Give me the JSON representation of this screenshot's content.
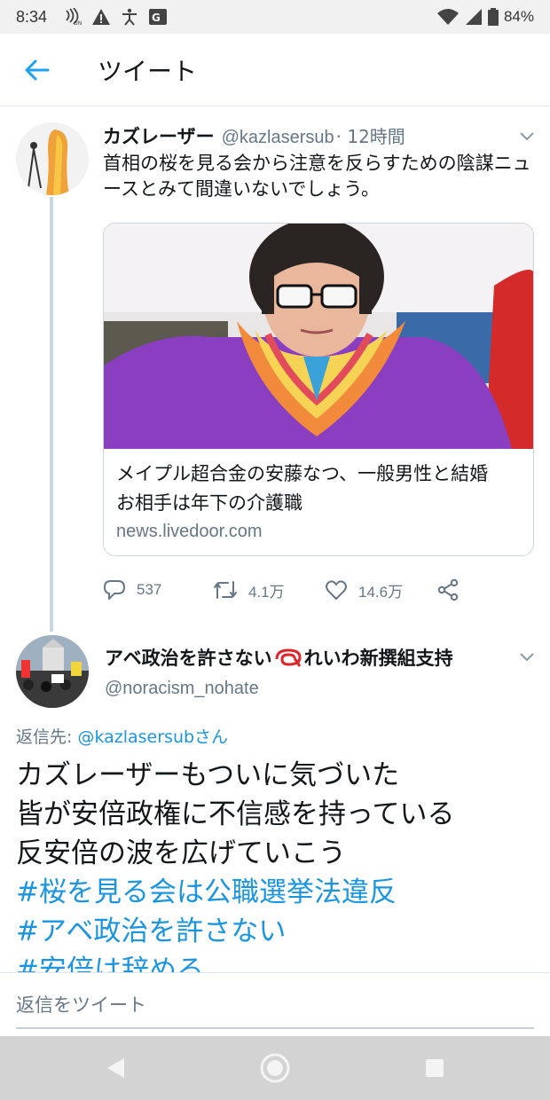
{
  "status_bar": {
    "time": "8:34",
    "battery": "84%",
    "icons": [
      "nfc-icon",
      "warning-icon",
      "accessibility-icon",
      "translate-icon",
      "wifi-icon",
      "signal-icon",
      "battery-icon"
    ]
  },
  "header": {
    "title": "ツイート",
    "back_icon": "arrow-left-icon"
  },
  "tweet": {
    "author_name": "カズレーザー",
    "author_handle": "@kazlasersub",
    "time": "· 12時間",
    "text": "首相の桜を見る会から注意を反らすための陰謀ニュースとみて間違いないでしょう。",
    "card": {
      "title": "メイプル超合金の安藤なつ、一般男性と結婚　お相手は年下の介護職",
      "domain": "news.livedoor.com"
    },
    "actions": {
      "replies": "537",
      "retweets": "4.1万",
      "likes": "14.6万"
    }
  },
  "reply": {
    "author_name_pre": "アベ政治を許さない",
    "author_name_post": "れいわ新撰組支持",
    "author_handle": "@noracism_nohate",
    "replying_label": "返信先: ",
    "replying_to": "@kazlasersubさん",
    "lines": [
      "カズレーザーもついに気づいた",
      "皆が安倍政権に不信感を持っている",
      "反安倍の波を広げていこう"
    ],
    "hashtags": [
      "#桜を見る会は公職選挙法違反",
      "#アベ政治を許さない",
      "#安倍は辞める"
    ]
  },
  "compose": {
    "placeholder": "返信をツイート"
  },
  "colors": {
    "accent": "#1da1f2",
    "link": "#1b95e0",
    "secondary_text": "#657786",
    "divider": "#e1e8ed"
  }
}
